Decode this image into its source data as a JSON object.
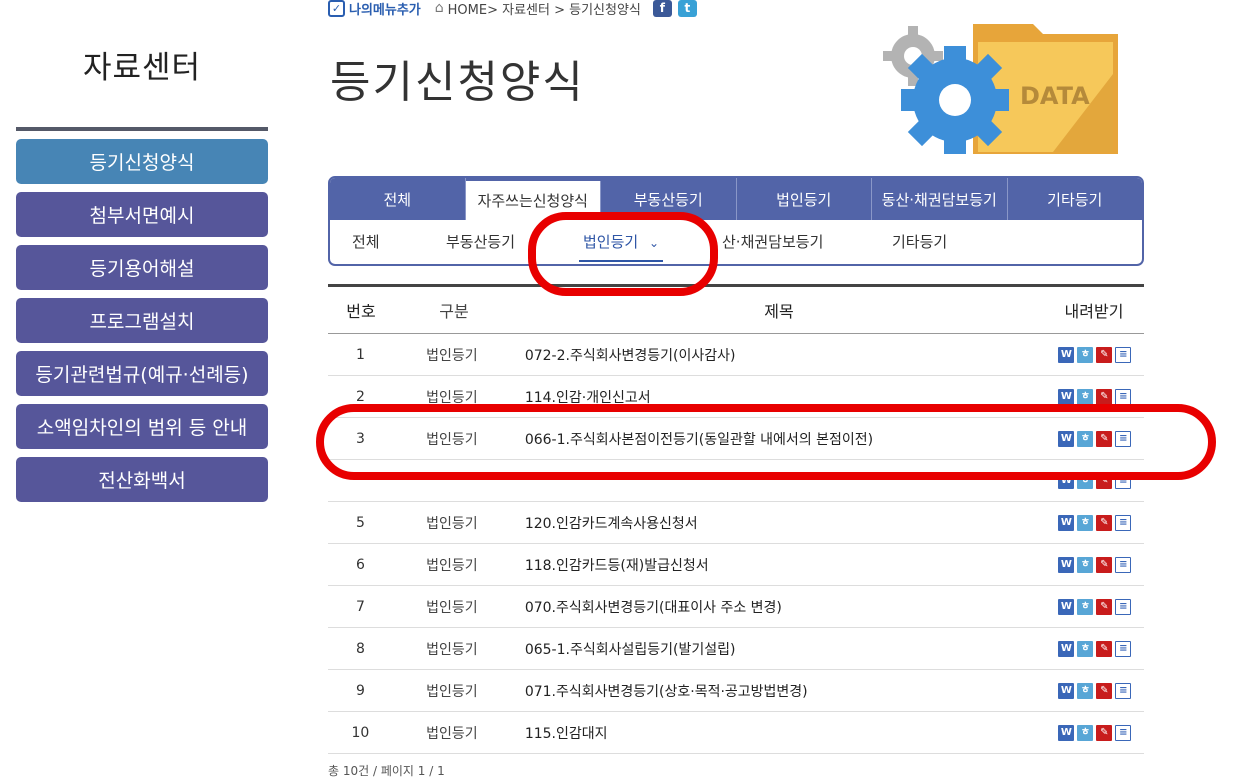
{
  "sidebar": {
    "title": "자료센터",
    "items": [
      {
        "label": "등기신청양식",
        "active": true
      },
      {
        "label": "첨부서면예시",
        "active": false
      },
      {
        "label": "등기용어해설",
        "active": false
      },
      {
        "label": "프로그램설치",
        "active": false
      },
      {
        "label": "등기관련법규(예규·선례등)",
        "active": false
      },
      {
        "label": "소액임차인의 범위 등 안내",
        "active": false
      },
      {
        "label": "전산화백서",
        "active": false
      }
    ]
  },
  "util": {
    "my_menu": "나의메뉴추가",
    "breadcrumb": "HOME> 자료센터 > 등기신청양식"
  },
  "page": {
    "title": "등기신청양식",
    "banner_text": "DATA"
  },
  "tabs_top": [
    {
      "label": "전체"
    },
    {
      "label": "자주쓰는신청양식"
    },
    {
      "label": "부동산등기"
    },
    {
      "label": "법인등기"
    },
    {
      "label": "동산·채권담보등기"
    },
    {
      "label": "기타등기"
    }
  ],
  "tabs_sub": [
    {
      "label": "전체"
    },
    {
      "label": "부동산등기"
    },
    {
      "label": "법인등기"
    },
    {
      "label": "산·채권담보등기"
    },
    {
      "label": "기타등기"
    }
  ],
  "table": {
    "headers": {
      "num": "번호",
      "cat": "구분",
      "title": "제목",
      "download": "내려받기"
    },
    "rows": [
      {
        "num": "1",
        "cat": "법인등기",
        "title": "072-2.주식회사변경등기(이사감사)"
      },
      {
        "num": "2",
        "cat": "법인등기",
        "title": "114.인감·개인신고서"
      },
      {
        "num": "3",
        "cat": "법인등기",
        "title": "066-1.주식회사본점이전등기(동일관할 내에서의 본점이전)"
      },
      {
        "num": "",
        "cat": "",
        "title": ""
      },
      {
        "num": "5",
        "cat": "법인등기",
        "title": "120.인감카드계속사용신청서"
      },
      {
        "num": "6",
        "cat": "법인등기",
        "title": "118.인감카드등(재)발급신청서"
      },
      {
        "num": "7",
        "cat": "법인등기",
        "title": "070.주식회사변경등기(대표이사 주소 변경)"
      },
      {
        "num": "8",
        "cat": "법인등기",
        "title": "065-1.주식회사설립등기(발기설립)"
      },
      {
        "num": "9",
        "cat": "법인등기",
        "title": "071.주식회사변경등기(상호·목적·공고방법변경)"
      },
      {
        "num": "10",
        "cat": "법인등기",
        "title": "115.인감대지"
      }
    ]
  },
  "footer": {
    "count": "총 10건 / 페이지 1 / 1"
  },
  "colors": {
    "sidebar": "#56569a",
    "sidebar_active": "#4785b5",
    "tab_bar": "#5264a8",
    "highlight": "#e80000"
  }
}
